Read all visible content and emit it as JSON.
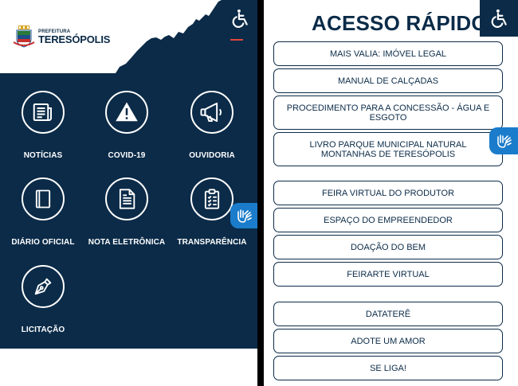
{
  "left": {
    "logo": {
      "line1": "PREFEITURA",
      "line2": "TERESÓPOLIS"
    },
    "tiles": [
      {
        "label": "NOTÍCIAS"
      },
      {
        "label": "COVID-19"
      },
      {
        "label": "OUVIDORIA"
      },
      {
        "label": "DIÁRIO OFICIAL"
      },
      {
        "label": "NOTA ELETRÔNICA"
      },
      {
        "label": "TRANSPARÊNCIA"
      },
      {
        "label": "LICITAÇÃO"
      }
    ]
  },
  "right": {
    "title": "ACESSO RÁPIDO",
    "buttons": [
      {
        "label": "MAIS VALIA: IMÓVEL LEGAL"
      },
      {
        "label": "MANUAL DE CALÇADAS"
      },
      {
        "label": "PROCEDIMENTO PARA A CONCESSÃO - ÁGUA E ESGOTO"
      },
      {
        "label": "LIVRO PARQUE MUNICIPAL NATURAL MONTANHAS DE TERESÓPOLIS"
      },
      {
        "label": "FEIRA VIRTUAL DO PRODUTOR"
      },
      {
        "label": "ESPAÇO DO EMPREENDEDOR"
      },
      {
        "label": "DOAÇÃO DO BEM"
      },
      {
        "label": "FEIRARTE VIRTUAL"
      },
      {
        "label": "DATATERÊ"
      },
      {
        "label": "ADOTE UM AMOR"
      },
      {
        "label": "SE LIGA!"
      }
    ]
  },
  "colors": {
    "navy": "#0b2b48",
    "accent_red": "#e0473a",
    "vlibras_blue": "#1a7ccb"
  },
  "icons": {
    "accessibility": "wheelchair-icon",
    "vlibras": "sign-language-hands-icon",
    "tiles": [
      "newspaper-icon",
      "warning-icon",
      "megaphone-icon",
      "book-icon",
      "document-icon",
      "clipboard-icon",
      "pen-nib-icon"
    ]
  }
}
